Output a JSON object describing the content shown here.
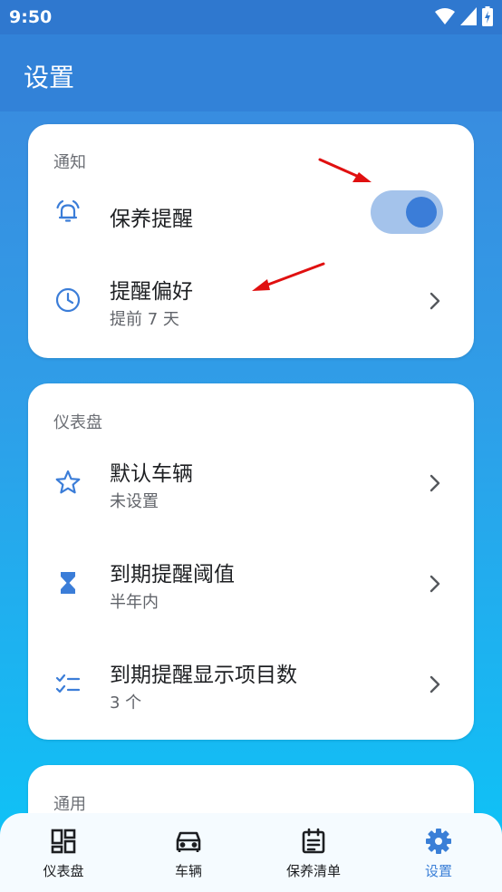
{
  "status_bar": {
    "time": "9:50"
  },
  "app_bar": {
    "title": "设置"
  },
  "notification_section": {
    "title": "通知",
    "maintenance_reminder": {
      "label": "保养提醒",
      "enabled": true
    },
    "reminder_preference": {
      "label": "提醒偏好",
      "value": "提前 7 天"
    }
  },
  "dashboard_section": {
    "title": "仪表盘",
    "items": [
      {
        "label": "默认车辆",
        "value": "未设置",
        "icon": "star-icon"
      },
      {
        "label": "到期提醒阈值",
        "value": "半年内",
        "icon": "hourglass-icon"
      },
      {
        "label": "到期提醒显示项目数",
        "value": "3 个",
        "icon": "checklist-icon"
      }
    ]
  },
  "general_section": {
    "title": "通用"
  },
  "bottom_nav": {
    "items": [
      {
        "label": "仪表盘",
        "icon": "dashboard-icon",
        "active": false
      },
      {
        "label": "车辆",
        "icon": "car-icon",
        "active": false
      },
      {
        "label": "保养清单",
        "icon": "calendar-list-icon",
        "active": false
      },
      {
        "label": "设置",
        "icon": "gear-icon",
        "active": true
      }
    ]
  },
  "colors": {
    "accent": "#3b7dd8",
    "app_bar": "#3282d8",
    "arrow": "#e01010",
    "toggle_track": "#a4c3eb"
  }
}
